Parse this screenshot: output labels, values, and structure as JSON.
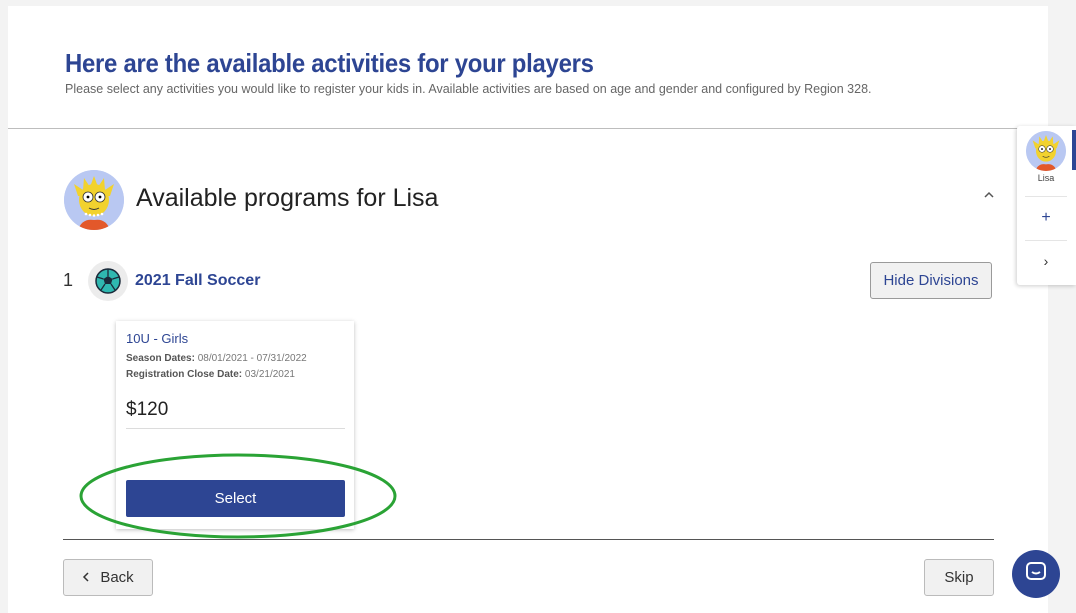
{
  "header": {
    "title": "Here are the available activities for your players",
    "subtitle": "Please select any activities you would like to register your kids in. Available activities are based on age and gender and configured by Region 328."
  },
  "player": {
    "heading": "Available programs for Lisa",
    "avatar_icon": "lisa-avatar-icon"
  },
  "program": {
    "number": "1",
    "name": "2021 Fall Soccer",
    "icon": "soccer-ball-icon",
    "hide_divisions_label": "Hide Divisions"
  },
  "division": {
    "title": "10U - Girls",
    "season_label": "Season Dates:",
    "season_value": "08/01/2021 - 07/31/2022",
    "close_label": "Registration Close Date:",
    "close_value": "03/21/2021",
    "price": "$120",
    "select_label": "Select"
  },
  "footer": {
    "back_label": "Back",
    "skip_label": "Skip"
  },
  "side_rail": {
    "player_name": "Lisa",
    "add_symbol": "+",
    "next_symbol": "›"
  },
  "colors": {
    "brand": "#2d4593",
    "highlight": "#2aa335"
  }
}
